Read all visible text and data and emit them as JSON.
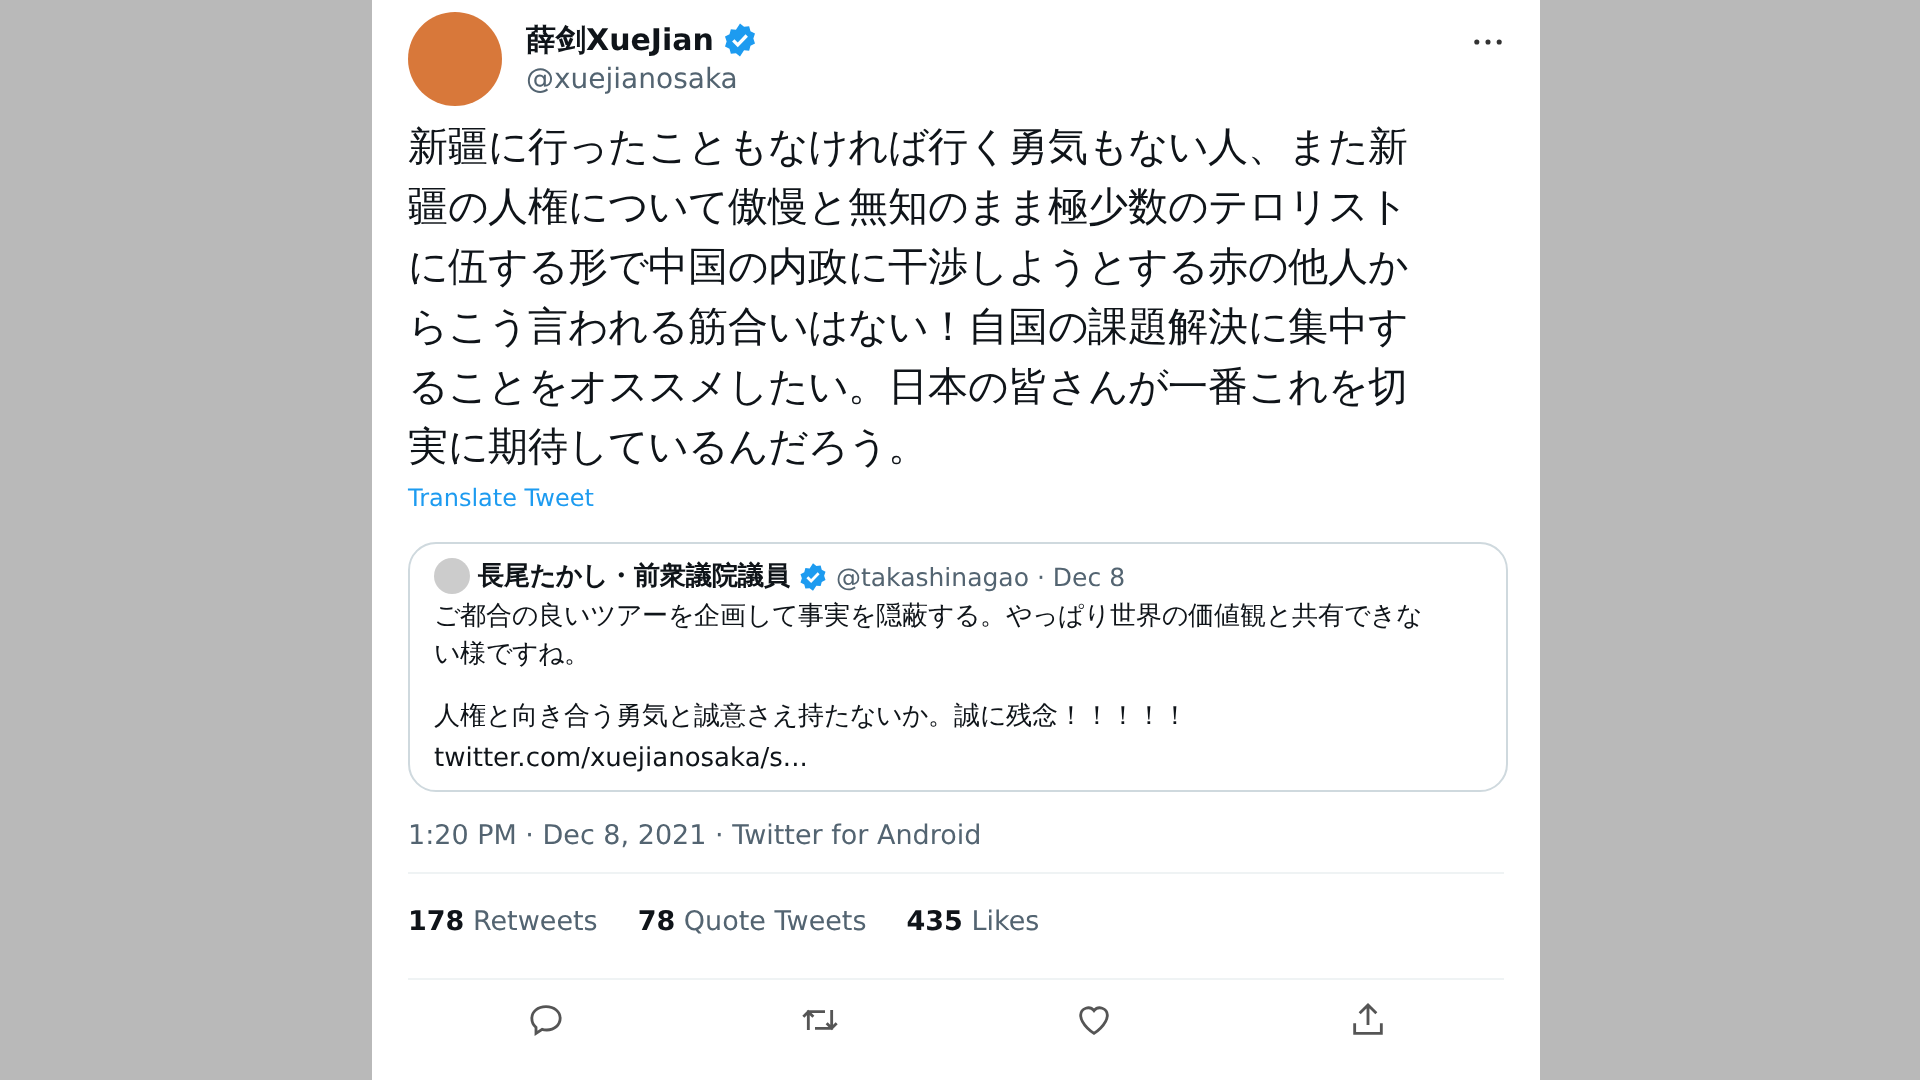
{
  "author": {
    "name": "薛剑XueJian",
    "verified": true,
    "handle": "@xuejianosaka"
  },
  "text": "新疆に行ったこともなければ行く勇気もない人、また新疆の人権について傲慢と無知のまま極少数のテロリストに伍する形で中国の内政に干渉しようとする赤の他人からこう言われる筋合いはない！自国の課題解決に集中することをオススメしたい。日本の皆さんが一番これを切実に期待しているんだろう。",
  "translate_link": "Translate Tweet",
  "quote": {
    "name": "長尾たかし・前衆議院議員",
    "verified": true,
    "handle": "@takashinagao",
    "date": "· Dec 8",
    "paragraphs": [
      "ご都合の良いツアーを企画して事実を隠蔽する。やっぱり世界の価値観と共有できない様ですね。",
      "人権と向き合う勇気と誠意さえ持たないか。誠に残念！！！！！"
    ],
    "link": "twitter.com/xuejianosaka/s..."
  },
  "timestamp": "1:20 PM · Dec 8, 2021 · Twitter for Android",
  "stats": [
    {
      "count": "178",
      "label": "Retweets"
    },
    {
      "count": "78",
      "label": "Quote Tweets"
    },
    {
      "count": "435",
      "label": "Likes"
    }
  ],
  "actions": [
    {
      "kind": "reply"
    },
    {
      "kind": "retweet"
    },
    {
      "kind": "like"
    },
    {
      "kind": "share"
    }
  ]
}
